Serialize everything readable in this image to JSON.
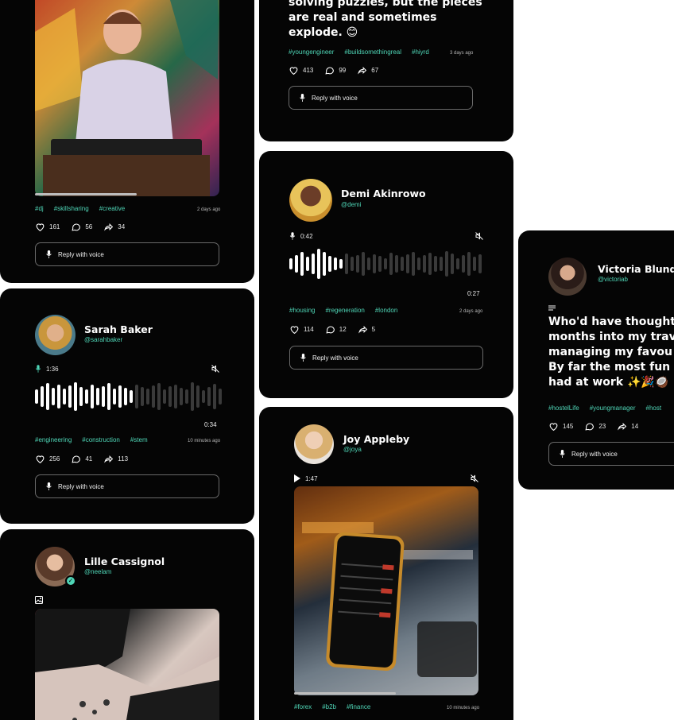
{
  "cards": {
    "dj": {
      "tags": [
        "#dj",
        "#skillsharing",
        "#creative"
      ],
      "time": "2 days ago",
      "likes": "161",
      "comments": "56",
      "shares": "34",
      "reply": "Reply with voice",
      "image_alt": "Man DJing at a decks in front of colourful mural"
    },
    "engineer": {
      "text_line1": "solving puzzles, but the pieces",
      "text_line2": "are real and sometimes",
      "text_line3": "explode. 😊",
      "tags": [
        "#youngengineer",
        "#buildsomethingreal",
        "#hiyrd"
      ],
      "time": "3 days ago",
      "likes": "413",
      "comments": "99",
      "shares": "67",
      "reply": "Reply with voice"
    },
    "demi": {
      "name": "Demi Akinrowo",
      "handle": "@demi",
      "duration": "0:42",
      "remaining": "0:27",
      "tags": [
        "#housing",
        "#regeneration",
        "#london"
      ],
      "time": "2 days ago",
      "likes": "114",
      "comments": "12",
      "shares": "5",
      "reply": "Reply with voice"
    },
    "sarah": {
      "name": "Sarah Baker",
      "handle": "@sarahbaker",
      "duration": "1:36",
      "remaining": "0:34",
      "tags": [
        "#engineering",
        "#construction",
        "#stem"
      ],
      "time": "10 minutes ago",
      "likes": "256",
      "comments": "41",
      "shares": "113",
      "reply": "Reply with voice"
    },
    "victoria": {
      "name": "Victoria Blundell",
      "handle": "@victoriab",
      "text_lines": [
        "Who'd have thought",
        "months into my trav",
        "managing my favou",
        "By far the most fun",
        "had at work ✨🎉🥥"
      ],
      "tags": [
        "#hostelLife",
        "#youngmanager",
        "#host"
      ],
      "likes": "145",
      "comments": "23",
      "shares": "14",
      "reply": "Reply with voice"
    },
    "joy": {
      "name": "Joy Appleby",
      "handle": "@joya",
      "duration": "1:47",
      "tags": [
        "#forex",
        "#b2b",
        "#finance"
      ],
      "time": "10 minutes ago"
    },
    "lille": {
      "name": "Lille Cassignol",
      "handle": "@neelam"
    }
  },
  "colors": {
    "accent": "#4fd6b7",
    "card": "#050505",
    "played": "#ffffff",
    "unplayed": "#3a3a3a"
  }
}
